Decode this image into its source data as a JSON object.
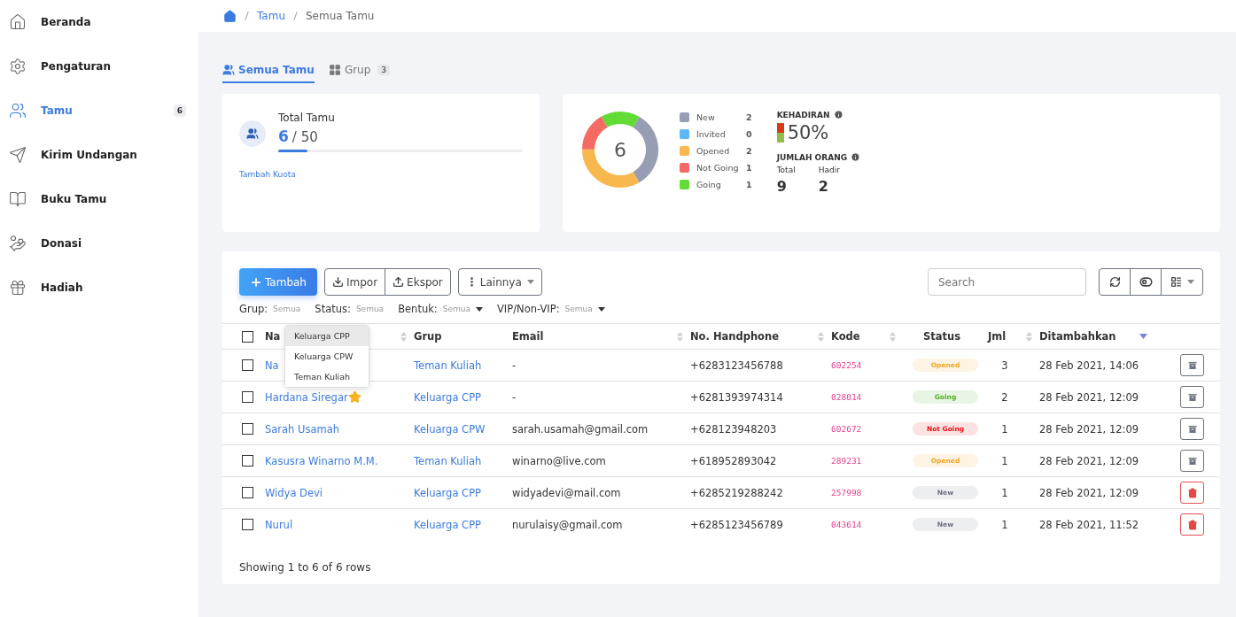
{
  "sidebar": {
    "items": [
      {
        "label": "Beranda",
        "selected": false
      },
      {
        "label": "Pengaturan",
        "selected": false
      },
      {
        "label": "Tamu",
        "selected": true,
        "badge": "6"
      },
      {
        "label": "Kirim Undangan",
        "selected": false
      },
      {
        "label": "Buku Tamu",
        "selected": false
      },
      {
        "label": "Donasi",
        "selected": false
      },
      {
        "label": "Hadiah",
        "selected": false
      }
    ]
  },
  "breadcrumb": [
    "Tamu",
    "Semua Tamu"
  ],
  "tabs": [
    {
      "label": "Semua Tamu",
      "selected": true
    },
    {
      "label": "Grup",
      "selected": false,
      "badge": "3"
    }
  ],
  "total_card": {
    "title": "Total Tamu",
    "count": "6",
    "limit": "/ 50",
    "level": 0.12,
    "link": "Tambah Kuota"
  },
  "summary": {
    "center": "6",
    "legend": [
      {
        "label": "New",
        "count": "2",
        "color": "#979eb4"
      },
      {
        "label": "Invited",
        "count": "0",
        "color": "#5bb8f5"
      },
      {
        "label": "Opened",
        "count": "2",
        "color": "#f9b84e"
      },
      {
        "label": "Not Going",
        "count": "1",
        "color": "#f36b63"
      },
      {
        "label": "Going",
        "count": "1",
        "color": "#62dc34"
      }
    ],
    "attendance": {
      "title": "KEHADIRAN",
      "level": 0.5,
      "value": "50%"
    },
    "people": {
      "title": "JUMLAH ORANG",
      "stats": [
        {
          "label": "Total",
          "value": "9"
        },
        {
          "label": "Hadir",
          "value": "2"
        }
      ]
    }
  },
  "toolbar": {
    "add": "Tambah",
    "import": "Impor",
    "export": "Ekspor",
    "more": "Lainnya",
    "search_placeholder": "Search"
  },
  "filters": [
    {
      "label": "Grup:",
      "value": "Semua",
      "caret": false
    },
    {
      "label": "Status:",
      "value": "Semua",
      "caret": false
    },
    {
      "label": "Bentuk:",
      "value": "Semua",
      "caret": true
    },
    {
      "label": "VIP/Non-VIP:",
      "value": "Semua",
      "caret": true
    }
  ],
  "group_dropdown": [
    {
      "label": "Keluarga CPP",
      "selected": true
    },
    {
      "label": "Keluarga CPW",
      "selected": false
    },
    {
      "label": "Teman Kuliah",
      "selected": false
    }
  ],
  "table": {
    "header_checked": false,
    "columns": [
      {
        "label": "Na",
        "kind": "sortable"
      },
      {
        "label": "Grup",
        "kind": "plain"
      },
      {
        "label": "Email",
        "kind": "sortable"
      },
      {
        "label": "No. Handphone",
        "kind": "sortable"
      },
      {
        "label": "Kode",
        "kind": "sortable"
      },
      {
        "label": "Status",
        "kind": "plain"
      },
      {
        "label": "Jml",
        "kind": "sortable"
      },
      {
        "label": "Ditambahkan",
        "kind": "sorted"
      }
    ],
    "rows": [
      {
        "checked": false,
        "name": "Na",
        "vip": false,
        "group": "Teman Kuliah",
        "email": "-",
        "phone": "+6283123456788",
        "code": "602254",
        "status": "Opened",
        "color": "#f5a623",
        "count": "3",
        "added": "28 Feb 2021, 14:06",
        "deletable": false
      },
      {
        "checked": false,
        "name": "Hardana Siregar",
        "vip": true,
        "group": "Keluarga CPP",
        "email": "-",
        "phone": "+6281393974314",
        "code": "028014",
        "status": "Going",
        "color": "#4caf20",
        "count": "2",
        "added": "28 Feb 2021, 12:09",
        "deletable": false
      },
      {
        "checked": false,
        "name": "Sarah Usamah",
        "vip": false,
        "group": "Keluarga CPW",
        "email": "sarah.usamah@gmail.com",
        "phone": "+628123948203",
        "code": "602672",
        "status": "Not Going",
        "color": "#ee1111",
        "count": "1",
        "added": "28 Feb 2021, 12:09",
        "deletable": false
      },
      {
        "checked": false,
        "name": "Kasusra Winarno M.M.",
        "vip": false,
        "group": "Teman Kuliah",
        "email": "winarno@live.com",
        "phone": "+618952893042",
        "code": "289231",
        "status": "Opened",
        "color": "#f5a623",
        "count": "1",
        "added": "28 Feb 2021, 12:09",
        "deletable": false
      },
      {
        "checked": false,
        "name": "Widya Devi",
        "vip": false,
        "group": "Keluarga CPP",
        "email": "widyadevi@mail.com",
        "phone": "+6285219288242",
        "code": "257998",
        "status": "New",
        "color": "#6b7080",
        "count": "1",
        "added": "28 Feb 2021, 12:09",
        "deletable": true
      },
      {
        "checked": false,
        "name": "Nurul",
        "vip": false,
        "group": "Keluarga CPP",
        "email": "nurulaisy@gmail.com",
        "phone": "+6285123456789",
        "code": "043614",
        "status": "New",
        "color": "#6b7080",
        "count": "1",
        "added": "28 Feb 2021, 11:52",
        "deletable": true
      }
    ],
    "footer": "Showing 1 to 6 of 6 rows"
  }
}
